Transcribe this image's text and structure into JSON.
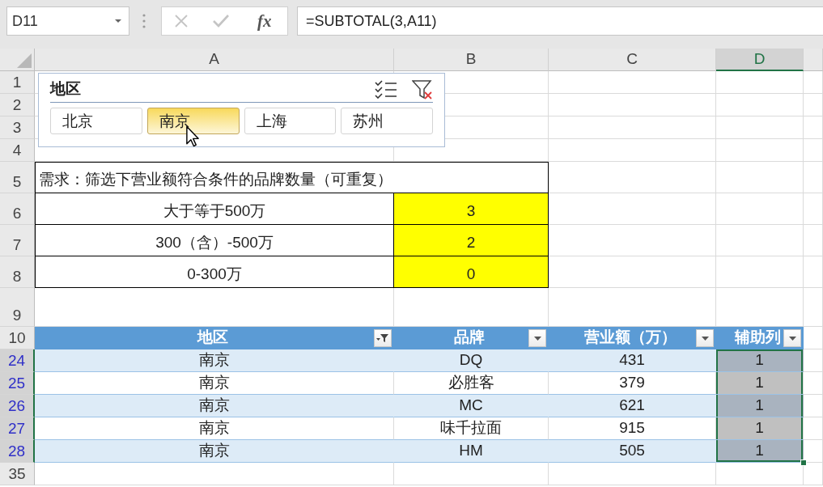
{
  "formula_bar": {
    "name_box": "D11",
    "editing": false,
    "function_label": "fx",
    "formula": "=SUBTOTAL(3,A11)"
  },
  "columns": [
    {
      "label": "A",
      "selected": false
    },
    {
      "label": "B",
      "selected": false
    },
    {
      "label": "C",
      "selected": false
    },
    {
      "label": "D",
      "selected": true
    }
  ],
  "row_headers": [
    {
      "label": "1",
      "selected": false,
      "filtered": false
    },
    {
      "label": "2",
      "selected": false,
      "filtered": false
    },
    {
      "label": "3",
      "selected": false,
      "filtered": false
    },
    {
      "label": "4",
      "selected": false,
      "filtered": false
    },
    {
      "label": "5",
      "selected": false,
      "filtered": false
    },
    {
      "label": "6",
      "selected": false,
      "filtered": false
    },
    {
      "label": "7",
      "selected": false,
      "filtered": false
    },
    {
      "label": "8",
      "selected": false,
      "filtered": false
    },
    {
      "label": "9",
      "selected": false,
      "filtered": false
    },
    {
      "label": "10",
      "selected": false,
      "filtered": false
    },
    {
      "label": "24",
      "selected": true,
      "filtered": true
    },
    {
      "label": "25",
      "selected": true,
      "filtered": true
    },
    {
      "label": "26",
      "selected": true,
      "filtered": true
    },
    {
      "label": "27",
      "selected": true,
      "filtered": true
    },
    {
      "label": "28",
      "selected": true,
      "filtered": true
    },
    {
      "label": "35",
      "selected": false,
      "filtered": false
    }
  ],
  "slicer": {
    "title": "地区",
    "items": [
      {
        "label": "北京",
        "selected": false
      },
      {
        "label": "南京",
        "selected": true
      },
      {
        "label": "上海",
        "selected": false
      },
      {
        "label": "苏州",
        "selected": false
      }
    ]
  },
  "requirement": {
    "title": "需求：筛选下营业额符合条件的品牌数量（可重复）",
    "criteria": [
      {
        "label": "大于等于500万",
        "count": "3"
      },
      {
        "label": "300（含）-500万",
        "count": "2"
      },
      {
        "label": "0-300万",
        "count": "0"
      }
    ]
  },
  "table": {
    "columns": [
      {
        "label": "地区",
        "filtered": true
      },
      {
        "label": "品牌",
        "filtered": false
      },
      {
        "label": "营业额（万）",
        "filtered": false
      },
      {
        "label": "辅助列",
        "filtered": false
      }
    ],
    "rows": [
      [
        "南京",
        "DQ",
        "431",
        "1"
      ],
      [
        "南京",
        "必胜客",
        "379",
        "1"
      ],
      [
        "南京",
        "MC",
        "621",
        "1"
      ],
      [
        "南京",
        "味千拉面",
        "915",
        "1"
      ],
      [
        "南京",
        "HM",
        "505",
        "1"
      ]
    ]
  }
}
